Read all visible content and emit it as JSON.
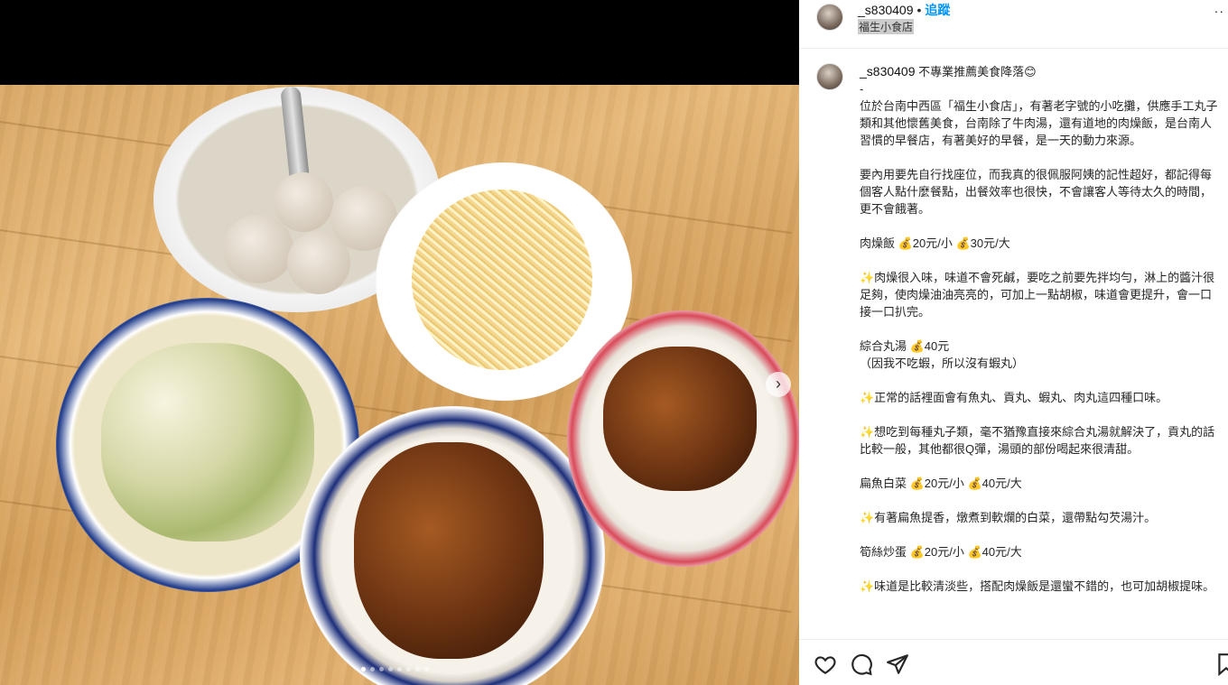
{
  "post": {
    "username": "_s830409",
    "follow_label": "追蹤",
    "separator": "•",
    "location": "福生小食店",
    "more_label": "··"
  },
  "caption": {
    "username": "_s830409",
    "text": " 不專業推薦美食降落😊\n-\n位於台南中西區「福生小食店」，有著老字號的小吃攤，供應手工丸子類和其他懷舊美食，台南除了牛肉湯，還有道地的肉燥飯，是台南人習慣的早餐店，有著美好的早餐，是一天的動力來源。\n\n要內用要先自行找座位，而我真的很佩服阿姨的記性超好，都記得每個客人點什麼餐點，出餐效率也很快，不會讓客人等待太久的時間，更不會餓著。\n\n肉燥飯 💰20元/小 💰30元/大\n\n✨肉燥很入味，味道不會死鹹，要吃之前要先拌均勻，淋上的醬汁很足夠，使肉燥油油亮亮的，可加上一點胡椒，味道會更提升，會一口接一口扒完。\n\n綜合丸湯 💰40元\n（因我不吃蝦，所以沒有蝦丸）\n\n✨正常的話裡面會有魚丸、貢丸、蝦丸、肉丸這四種口味。\n\n✨想吃到每種丸子類，毫不猶豫直接來綜合丸湯就解決了，貢丸的話比較一般，其他都很Q彈，湯頭的部份喝起來很清甜。\n\n扁魚白菜 💰20元/小 💰40元/大\n\n✨有著扁魚提香，燉煮到軟爛的白菜，還帶點勾芡湯汁。\n\n筍絲炒蛋 💰20元/小 💰40元/大\n\n✨味道是比較清淡些，搭配肉燥飯是還蠻不錯的，也可加胡椒提味。"
  },
  "actions": {
    "like_icon": "heart-icon",
    "comment_icon": "comment-icon",
    "share_icon": "share-icon",
    "save_icon": "bookmark-icon"
  },
  "carousel": {
    "dot_count": 8,
    "active_index": 0,
    "next_icon": "chevron-right-icon",
    "next_glyph": "›"
  }
}
